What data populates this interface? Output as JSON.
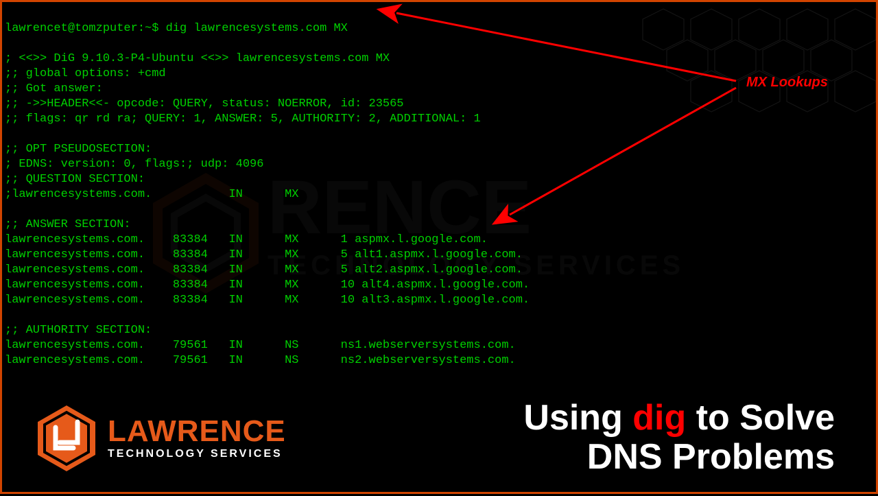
{
  "terminal": {
    "prompt": "lawrencet@tomzputer:~$ dig lawrencesystems.com MX",
    "header0": "; <<>> DiG 9.10.3-P4-Ubuntu <<>> lawrencesystems.com MX",
    "header1": ";; global options: +cmd",
    "header2": ";; Got answer:",
    "header3": ";; ->>HEADER<<- opcode: QUERY, status: NOERROR, id: 23565",
    "header4": ";; flags: qr rd ra; QUERY: 1, ANSWER: 5, AUTHORITY: 2, ADDITIONAL: 1",
    "opt0": ";; OPT PSEUDOSECTION:",
    "opt1": "; EDNS: version: 0, flags:; udp: 4096",
    "question0": ";; QUESTION SECTION:",
    "question1": ";lawrencesystems.com.           IN      MX",
    "answer_hdr": ";; ANSWER SECTION:",
    "a0": "lawrencesystems.com.    83384   IN      MX      1 aspmx.l.google.com.",
    "a1": "lawrencesystems.com.    83384   IN      MX      5 alt1.aspmx.l.google.com.",
    "a2": "lawrencesystems.com.    83384   IN      MX      5 alt2.aspmx.l.google.com.",
    "a3": "lawrencesystems.com.    83384   IN      MX      10 alt4.aspmx.l.google.com.",
    "a4": "lawrencesystems.com.    83384   IN      MX      10 alt3.aspmx.l.google.com.",
    "auth_hdr": ";; AUTHORITY SECTION:",
    "auth0": "lawrencesystems.com.    79561   IN      NS      ns1.webserversystems.com.",
    "auth1": "lawrencesystems.com.    79561   IN      NS      ns2.webserversystems.com."
  },
  "annotation": {
    "label": "MX Lookups"
  },
  "logo": {
    "main": "LAWRENCE",
    "sub": "TECHNOLOGY SERVICES"
  },
  "title": {
    "p1": "Using ",
    "highlight": "dig",
    "p2": " to Solve",
    "p3": "DNS Problems"
  }
}
